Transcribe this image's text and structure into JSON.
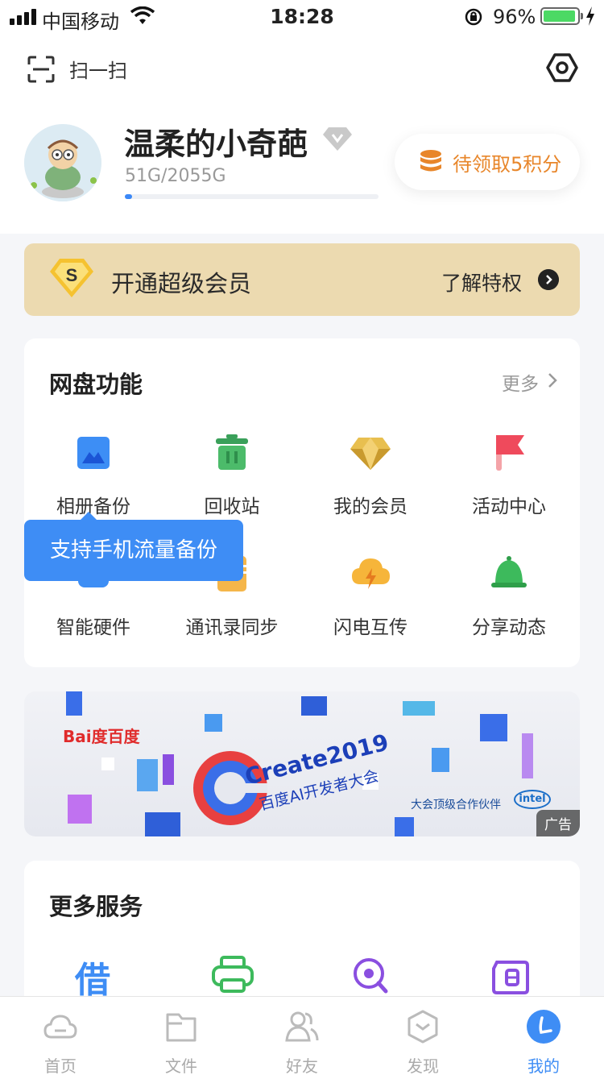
{
  "status_bar": {
    "carrier": "中国移动",
    "time": "18:28",
    "battery": "96%"
  },
  "header": {
    "scan_label": "扫一扫"
  },
  "profile": {
    "username": "温柔的小奇葩",
    "storage_text": "51G/2055G",
    "storage_used_fraction": 0.025,
    "points_label": "待领取5积分"
  },
  "vip_banner": {
    "title": "开通超级会员",
    "link_label": "了解特权",
    "badge_letter": "S"
  },
  "features": {
    "title": "网盘功能",
    "more_label": "更多",
    "items": [
      {
        "label": "相册备份",
        "icon": "photo-backup-icon"
      },
      {
        "label": "回收站",
        "icon": "trash-icon"
      },
      {
        "label": "我的会员",
        "icon": "diamond-icon"
      },
      {
        "label": "活动中心",
        "icon": "flag-icon"
      },
      {
        "label": "智能硬件",
        "icon": "smart-hardware-icon"
      },
      {
        "label": "通讯录同步",
        "icon": "contacts-sync-icon"
      },
      {
        "label": "闪电互传",
        "icon": "lightning-cloud-icon"
      },
      {
        "label": "分享动态",
        "icon": "bell-icon"
      }
    ],
    "tooltip": "支持手机流量备份"
  },
  "ad": {
    "tag": "广告",
    "brand": "Bai度百度",
    "main_text": "Create2019",
    "sub_text": "百度AI开发者大会",
    "partner_text": "大会顶级合作伙伴",
    "partner_logo": "intel"
  },
  "services": {
    "title": "更多服务",
    "loan_glyph": "借"
  },
  "tabbar": {
    "items": [
      {
        "label": "首页",
        "icon": "cloud-icon"
      },
      {
        "label": "文件",
        "icon": "folder-icon"
      },
      {
        "label": "好友",
        "icon": "friends-icon"
      },
      {
        "label": "发现",
        "icon": "discover-icon"
      },
      {
        "label": "我的",
        "icon": "profile-icon",
        "active": true
      }
    ]
  },
  "colors": {
    "accent": "#3e8df5",
    "vip_gold": "#ecdab0",
    "points_orange": "#e8862a"
  }
}
